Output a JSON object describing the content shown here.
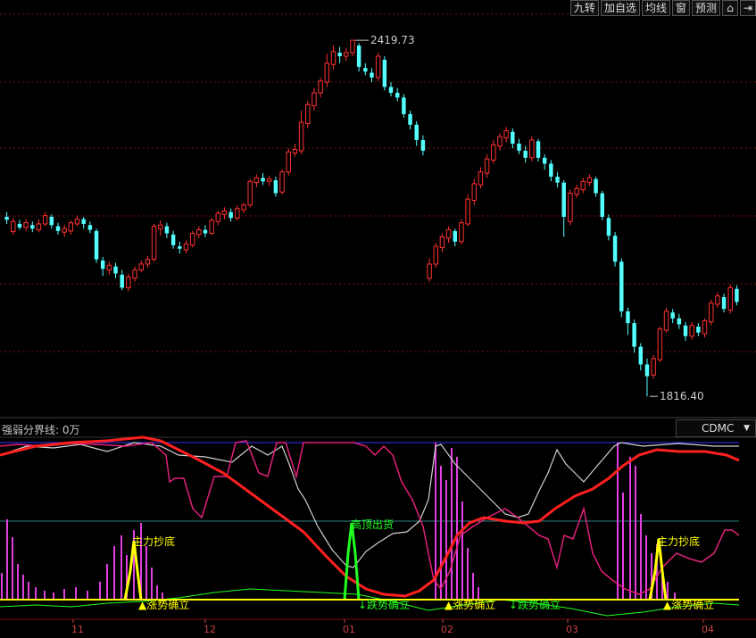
{
  "toolbar": {
    "buttons": [
      "九转",
      "加自选",
      "均线",
      "窗",
      "预测"
    ],
    "icons": [
      "lock-icon",
      "exit-icon"
    ]
  },
  "subchart": {
    "label": "强弱分界线: 0万",
    "tab": "CDMC"
  },
  "colors": {
    "up": "#ff3030",
    "down": "#54ffff",
    "grid": "#7a1010",
    "ma": "#ff2020",
    "white_line": "#d0d0d0",
    "pink_line": "#e0207a",
    "magenta_bar": "#e040e0",
    "yellow": "#ffff00",
    "green": "#20ff20"
  },
  "chart_data": [
    {
      "type": "candlestick",
      "high_label": "2419.73",
      "low_label": "1816.40",
      "ylim": [
        1780,
        2460
      ],
      "candles": [
        [
          2120,
          2115,
          2128,
          2108
        ],
        [
          2095,
          2112,
          2118,
          2090
        ],
        [
          2108,
          2102,
          2115,
          2098
        ],
        [
          2102,
          2110,
          2116,
          2096
        ],
        [
          2106,
          2100,
          2112,
          2094
        ],
        [
          2098,
          2108,
          2116,
          2094
        ],
        [
          2108,
          2122,
          2128,
          2104
        ],
        [
          2120,
          2106,
          2124,
          2100
        ],
        [
          2104,
          2096,
          2110,
          2090
        ],
        [
          2094,
          2100,
          2106,
          2086
        ],
        [
          2096,
          2110,
          2114,
          2090
        ],
        [
          2108,
          2116,
          2122,
          2104
        ],
        [
          2116,
          2108,
          2120,
          2100
        ],
        [
          2106,
          2098,
          2112,
          2092
        ],
        [
          2096,
          2048,
          2100,
          2042
        ],
        [
          2046,
          2032,
          2052,
          2020
        ],
        [
          2030,
          2038,
          2044,
          2022
        ],
        [
          2036,
          2024,
          2042,
          2016
        ],
        [
          2022,
          2000,
          2030,
          1996
        ],
        [
          2000,
          2018,
          2024,
          1994
        ],
        [
          2016,
          2030,
          2036,
          2010
        ],
        [
          2030,
          2040,
          2046,
          2026
        ],
        [
          2040,
          2048,
          2054,
          2034
        ],
        [
          2048,
          2104,
          2108,
          2044
        ],
        [
          2100,
          2106,
          2114,
          2088
        ],
        [
          2104,
          2092,
          2110,
          2084
        ],
        [
          2090,
          2072,
          2096,
          2066
        ],
        [
          2070,
          2066,
          2078,
          2058
        ],
        [
          2064,
          2074,
          2080,
          2058
        ],
        [
          2072,
          2092,
          2096,
          2068
        ],
        [
          2090,
          2098,
          2104,
          2084
        ],
        [
          2098,
          2092,
          2106,
          2086
        ],
        [
          2092,
          2114,
          2118,
          2090
        ],
        [
          2112,
          2126,
          2130,
          2106
        ],
        [
          2124,
          2130,
          2136,
          2116
        ],
        [
          2128,
          2118,
          2134,
          2112
        ],
        [
          2118,
          2134,
          2140,
          2114
        ],
        [
          2132,
          2140,
          2144,
          2126
        ],
        [
          2140,
          2180,
          2184,
          2136
        ],
        [
          2178,
          2186,
          2192,
          2170
        ],
        [
          2186,
          2180,
          2194,
          2174
        ],
        [
          2180,
          2184,
          2190,
          2172
        ],
        [
          2182,
          2160,
          2188,
          2154
        ],
        [
          2162,
          2196,
          2200,
          2158
        ],
        [
          2196,
          2230,
          2236,
          2190
        ],
        [
          2228,
          2234,
          2244,
          2222
        ],
        [
          2232,
          2280,
          2300,
          2226
        ],
        [
          2278,
          2310,
          2316,
          2270
        ],
        [
          2308,
          2330,
          2338,
          2300
        ],
        [
          2330,
          2350,
          2356,
          2322
        ],
        [
          2348,
          2380,
          2396,
          2340
        ],
        [
          2378,
          2400,
          2410,
          2370
        ],
        [
          2398,
          2392,
          2408,
          2380
        ],
        [
          2392,
          2398,
          2406,
          2384
        ],
        [
          2398,
          2419,
          2419,
          2392
        ],
        [
          2410,
          2374,
          2414,
          2366
        ],
        [
          2372,
          2366,
          2380,
          2360
        ],
        [
          2364,
          2356,
          2372,
          2348
        ],
        [
          2356,
          2392,
          2398,
          2350
        ],
        [
          2386,
          2340,
          2392,
          2334
        ],
        [
          2340,
          2330,
          2348,
          2324
        ],
        [
          2330,
          2322,
          2338,
          2316
        ],
        [
          2322,
          2294,
          2328,
          2288
        ],
        [
          2294,
          2276,
          2300,
          2268
        ],
        [
          2276,
          2250,
          2282,
          2240
        ],
        [
          2250,
          2232,
          2258,
          2224
        ],
        [
          2016,
          2040,
          2050,
          2010
        ],
        [
          2040,
          2070,
          2076,
          2034
        ],
        [
          2068,
          2086,
          2092,
          2060
        ],
        [
          2084,
          2098,
          2104,
          2076
        ],
        [
          2096,
          2078,
          2100,
          2070
        ],
        [
          2078,
          2110,
          2116,
          2074
        ],
        [
          2108,
          2150,
          2158,
          2104
        ],
        [
          2148,
          2176,
          2184,
          2140
        ],
        [
          2174,
          2196,
          2204,
          2168
        ],
        [
          2194,
          2218,
          2226,
          2186
        ],
        [
          2216,
          2242,
          2250,
          2210
        ],
        [
          2240,
          2256,
          2262,
          2232
        ],
        [
          2254,
          2266,
          2272,
          2246
        ],
        [
          2264,
          2244,
          2270,
          2236
        ],
        [
          2244,
          2232,
          2252,
          2226
        ],
        [
          2232,
          2220,
          2240,
          2212
        ],
        [
          2220,
          2250,
          2256,
          2214
        ],
        [
          2248,
          2220,
          2252,
          2214
        ],
        [
          2220,
          2210,
          2226,
          2200
        ],
        [
          2210,
          2188,
          2216,
          2180
        ],
        [
          2188,
          2178,
          2196,
          2170
        ],
        [
          2178,
          2120,
          2182,
          2086
        ],
        [
          2112,
          2160,
          2166,
          2106
        ],
        [
          2158,
          2168,
          2174,
          2152
        ],
        [
          2166,
          2180,
          2186,
          2160
        ],
        [
          2178,
          2186,
          2192,
          2172
        ],
        [
          2184,
          2160,
          2188,
          2154
        ],
        [
          2160,
          2120,
          2164,
          2114
        ],
        [
          2118,
          2088,
          2124,
          2080
        ],
        [
          2088,
          2044,
          2094,
          2036
        ],
        [
          2044,
          1960,
          2050,
          1950
        ],
        [
          1960,
          1940,
          1966,
          1920
        ],
        [
          1940,
          1900,
          1946,
          1890
        ],
        [
          1900,
          1870,
          1906,
          1860
        ],
        [
          1870,
          1850,
          1880,
          1816
        ],
        [
          1852,
          1880,
          1886,
          1846
        ],
        [
          1878,
          1930,
          1934,
          1874
        ],
        [
          1928,
          1960,
          1966,
          1924
        ],
        [
          1958,
          1948,
          1964,
          1940
        ],
        [
          1948,
          1938,
          1956,
          1930
        ],
        [
          1936,
          1918,
          1942,
          1910
        ],
        [
          1918,
          1936,
          1942,
          1912
        ],
        [
          1934,
          1924,
          1940,
          1918
        ],
        [
          1922,
          1944,
          1948,
          1916
        ],
        [
          1942,
          1974,
          1980,
          1936
        ],
        [
          1972,
          1986,
          1992,
          1966
        ],
        [
          1984,
          1964,
          1990,
          1958
        ],
        [
          1962,
          2000,
          2006,
          1956
        ],
        [
          1998,
          1976,
          2004,
          1970
        ]
      ]
    },
    {
      "type": "line",
      "x_ticks": [
        "11",
        "12",
        "01",
        "02",
        "03",
        "04"
      ],
      "annotations": [
        "主力抄底",
        "高顶出货",
        "主力抄底"
      ],
      "markers": [
        "涨势确立",
        "跌势确立",
        "涨势确立",
        "跌势确立",
        "涨势确立"
      ]
    }
  ]
}
